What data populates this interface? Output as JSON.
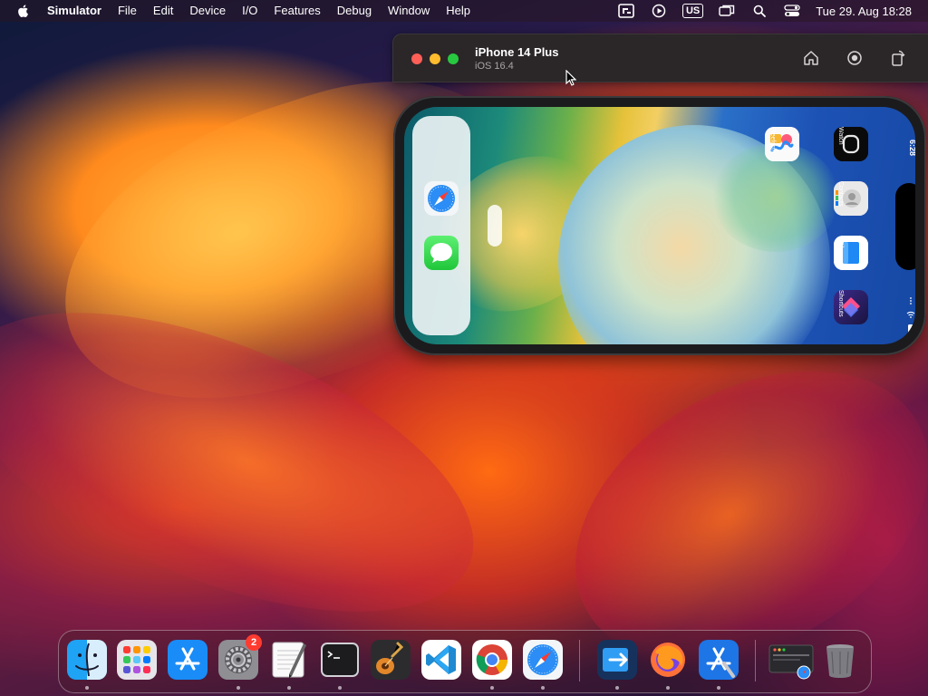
{
  "menubar": {
    "app_name": "Simulator",
    "items": [
      "File",
      "Edit",
      "Device",
      "I/O",
      "Features",
      "Debug",
      "Window",
      "Help"
    ],
    "input_source": "US",
    "clock": "Tue 29. Aug  18:28"
  },
  "simulator": {
    "device_name": "iPhone 14 Plus",
    "os_version": "iOS 16.4"
  },
  "iphone": {
    "time": "6:28",
    "apps": [
      {
        "label": "Freeform",
        "icon": "freeform-icon"
      },
      {
        "label": "Watch",
        "icon": "watch-icon"
      },
      {
        "label": "Contacts",
        "icon": "contacts-icon"
      },
      {
        "label": "Files",
        "icon": "files-icon"
      },
      {
        "label": "Shortcuts",
        "icon": "shortcuts-icon"
      }
    ],
    "dock_apps": [
      "safari-icon",
      "messages-icon"
    ]
  },
  "dock": {
    "system_settings_badge": "2",
    "items": [
      "finder-icon",
      "launchpad-icon",
      "app-store-icon",
      "system-settings-icon",
      "textedit-icon",
      "terminal-icon",
      "instruments-icon",
      "vscode-icon",
      "chrome-icon",
      "safari-icon",
      "migration-assistant-icon",
      "firefox-icon",
      "xcode-icon",
      "recent-window-icon",
      "trash-icon"
    ]
  },
  "colors": {
    "close": "#fe5f57",
    "minimize": "#febc2e",
    "zoom": "#28c840",
    "badge": "#ff3b30"
  }
}
